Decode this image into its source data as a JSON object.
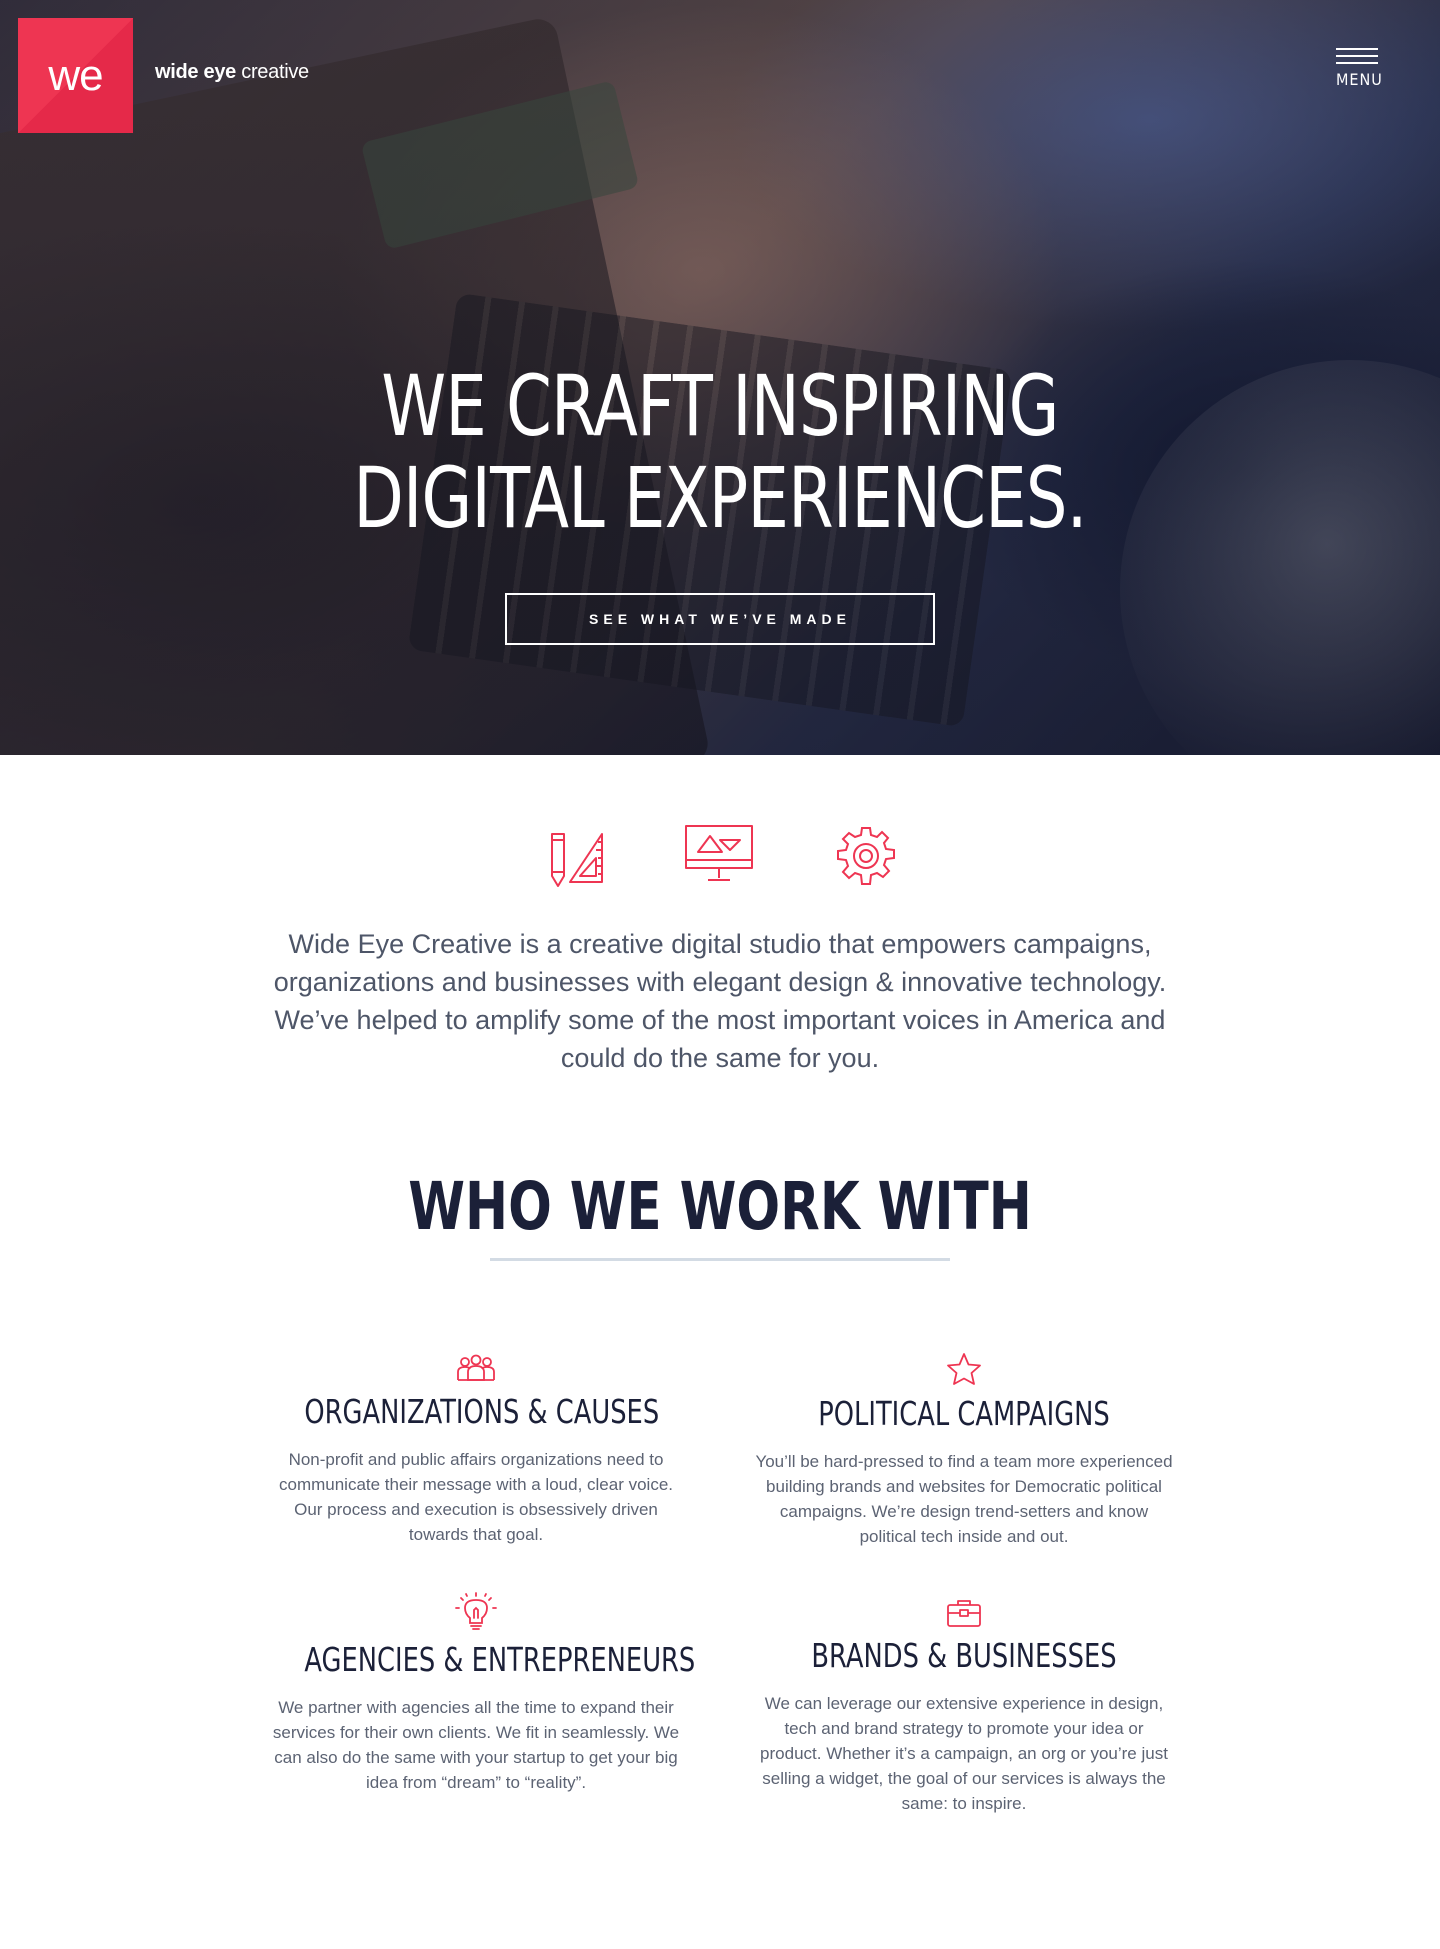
{
  "header": {
    "logo_mark": "we",
    "brand_bold": "wide eye",
    "brand_light": " creative",
    "menu_label": "MENU"
  },
  "hero": {
    "title_line1": "WE CRAFT INSPIRING",
    "title_line2": "DIGITAL EXPERIENCES.",
    "cta_label": "SEE WHAT WE’VE MADE"
  },
  "intro": {
    "icons": [
      "pencil-ruler-icon",
      "monitor-design-icon",
      "gear-icon"
    ],
    "text": "Wide Eye Creative is a creative digital studio that empowers campaigns, organizations and businesses with elegant design & innovative technology. We’ve helped to amplify some of the most important voices in America and could do the same for you."
  },
  "who": {
    "title": "WHO WE WORK WITH",
    "cards": [
      {
        "icon": "people-group-icon",
        "title": "ORGANIZATIONS & CAUSES",
        "body": "Non-profit and public affairs organizations need to communicate their message with a loud, clear voice. Our process and execution is obsessively driven towards that goal."
      },
      {
        "icon": "star-icon",
        "title": "POLITICAL CAMPAIGNS",
        "body": "You’ll be hard-pressed to find a team more experienced building brands and websites for Democratic political campaigns. We’re design trend-setters and know political tech inside and out."
      },
      {
        "icon": "lightbulb-icon",
        "title": "AGENCIES & ENTREPRENEURS",
        "body": "We partner with agencies all the time to expand their services for their own clients. We fit in seamlessly. We can also do the same with your startup to get your big idea from “dream” to “reality”."
      },
      {
        "icon": "briefcase-icon",
        "title": "BRANDS & BUSINESSES",
        "body": "We can leverage our extensive experience in design, tech and brand strategy to promote your idea or product. Whether it’s a campaign, an org or you’re just selling a widget, the goal of our services is always the same: to inspire."
      }
    ]
  },
  "colors": {
    "accent": "#ee3552",
    "heading": "#1b2038",
    "body_text": "#5c6373",
    "rule": "#d3dbe4"
  }
}
